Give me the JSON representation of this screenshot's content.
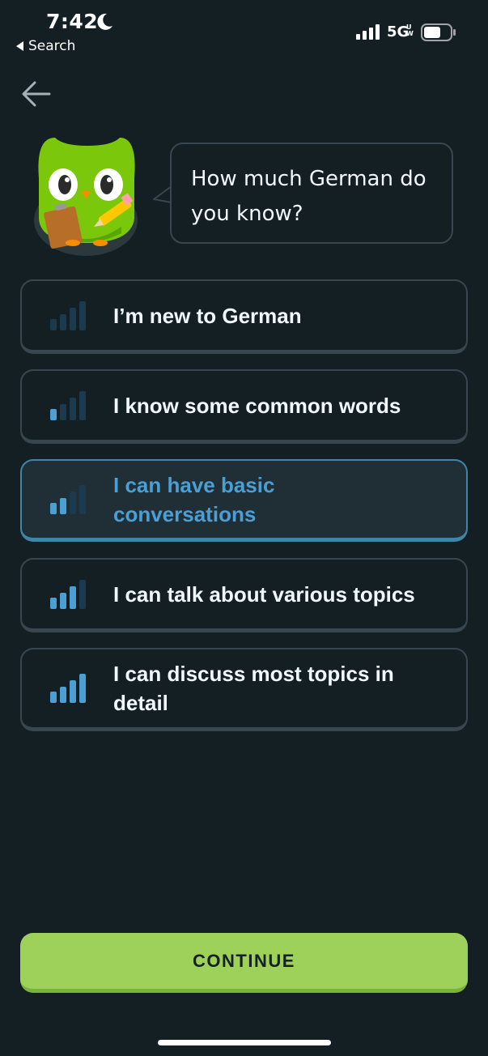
{
  "status_bar": {
    "time": "7:42",
    "back_app": "Search",
    "network": "5G",
    "network_sup": "UW"
  },
  "question": "How much German do you know?",
  "options": [
    {
      "label": "I’m new to German",
      "level": 0,
      "selected": false
    },
    {
      "label": "I know some common words",
      "level": 1,
      "selected": false
    },
    {
      "label": "I can have basic conversations",
      "level": 2,
      "selected": true
    },
    {
      "label": "I can talk about various topics",
      "level": 3,
      "selected": false
    },
    {
      "label": "I can discuss most topics in detail",
      "level": 4,
      "selected": false
    }
  ],
  "continue_label": "CONTINUE",
  "colors": {
    "background": "#141f24",
    "border": "#37464f",
    "accent_blue": "#4a9fd4",
    "bar_dim": "#1c3a4e",
    "continue_green": "#9dd15a"
  },
  "icons": [
    "moon-icon",
    "signal-icon",
    "battery-icon",
    "back-arrow-icon",
    "duo-owl-mascot",
    "signal-bars-icon"
  ]
}
